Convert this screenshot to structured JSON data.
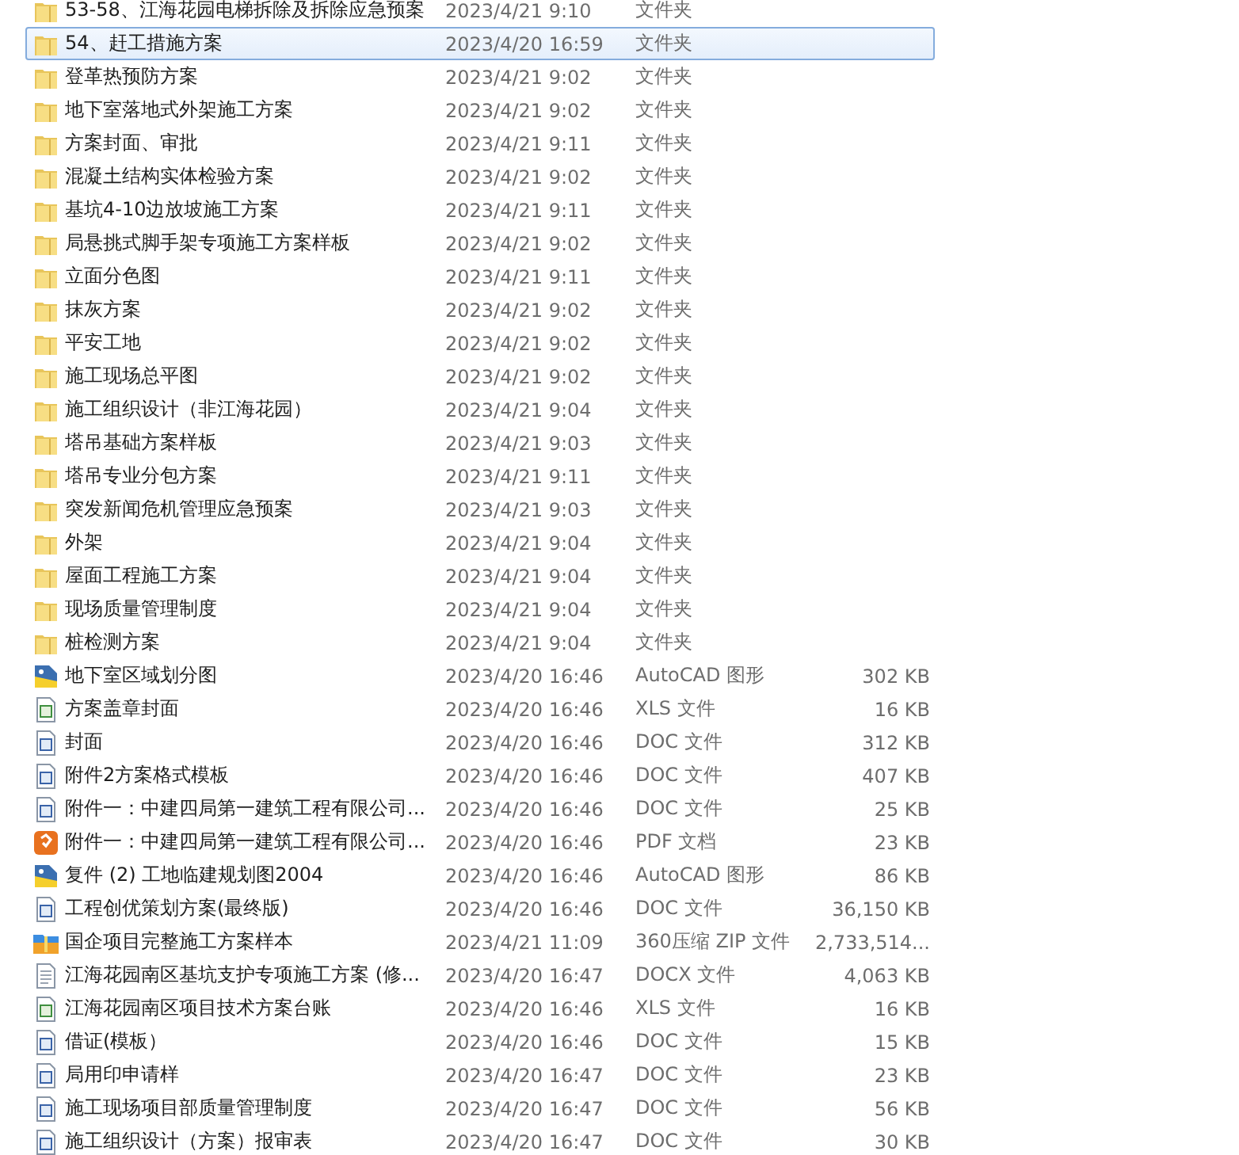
{
  "files": [
    {
      "name": "53-58、江海花园电梯拆除及拆除应急预案",
      "kind": "folder",
      "modified": "2023/4/21 9:10",
      "type": "文件夹",
      "selected": false
    },
    {
      "name": "54、赶工措施方案",
      "kind": "folder",
      "modified": "2023/4/20 16:59",
      "type": "文件夹",
      "selected": true
    },
    {
      "name": "登革热预防方案",
      "kind": "folder",
      "modified": "2023/4/21 9:02",
      "type": "文件夹",
      "selected": false
    },
    {
      "name": "地下室落地式外架施工方案",
      "kind": "folder",
      "modified": "2023/4/21 9:02",
      "type": "文件夹",
      "selected": false
    },
    {
      "name": "方案封面、审批",
      "kind": "folder",
      "modified": "2023/4/21 9:11",
      "type": "文件夹",
      "selected": false
    },
    {
      "name": "混凝土结构实体检验方案",
      "kind": "folder",
      "modified": "2023/4/21 9:02",
      "type": "文件夹",
      "selected": false
    },
    {
      "name": "基坑4-10边放坡施工方案",
      "kind": "folder",
      "modified": "2023/4/21 9:11",
      "type": "文件夹",
      "selected": false
    },
    {
      "name": "局悬挑式脚手架专项施工方案样板",
      "kind": "folder",
      "modified": "2023/4/21 9:02",
      "type": "文件夹",
      "selected": false
    },
    {
      "name": "立面分色图",
      "kind": "folder",
      "modified": "2023/4/21 9:11",
      "type": "文件夹",
      "selected": false
    },
    {
      "name": "抹灰方案",
      "kind": "folder",
      "modified": "2023/4/21 9:02",
      "type": "文件夹",
      "selected": false
    },
    {
      "name": "平安工地",
      "kind": "folder",
      "modified": "2023/4/21 9:02",
      "type": "文件夹",
      "selected": false
    },
    {
      "name": "施工现场总平图",
      "kind": "folder",
      "modified": "2023/4/21 9:02",
      "type": "文件夹",
      "selected": false
    },
    {
      "name": "施工组织设计（非江海花园）",
      "kind": "folder",
      "modified": "2023/4/21 9:04",
      "type": "文件夹",
      "selected": false
    },
    {
      "name": "塔吊基础方案样板",
      "kind": "folder",
      "modified": "2023/4/21 9:03",
      "type": "文件夹",
      "selected": false
    },
    {
      "name": "塔吊专业分包方案",
      "kind": "folder",
      "modified": "2023/4/21 9:11",
      "type": "文件夹",
      "selected": false
    },
    {
      "name": "突发新闻危机管理应急预案",
      "kind": "folder",
      "modified": "2023/4/21 9:03",
      "type": "文件夹",
      "selected": false
    },
    {
      "name": "外架",
      "kind": "folder",
      "modified": "2023/4/21 9:04",
      "type": "文件夹",
      "selected": false
    },
    {
      "name": "屋面工程施工方案",
      "kind": "folder",
      "modified": "2023/4/21 9:04",
      "type": "文件夹",
      "selected": false
    },
    {
      "name": "现场质量管理制度",
      "kind": "folder",
      "modified": "2023/4/21 9:04",
      "type": "文件夹",
      "selected": false
    },
    {
      "name": "桩检测方案",
      "kind": "folder",
      "modified": "2023/4/21 9:04",
      "type": "文件夹",
      "selected": false
    },
    {
      "name": "地下室区域划分图",
      "kind": "cad",
      "modified": "2023/4/20 16:46",
      "type": "AutoCAD 图形",
      "size": "302 KB",
      "selected": false
    },
    {
      "name": "方案盖章封面",
      "kind": "xls",
      "modified": "2023/4/20 16:46",
      "type": "XLS 文件",
      "size": "16 KB",
      "selected": false
    },
    {
      "name": "封面",
      "kind": "doc",
      "modified": "2023/4/20 16:46",
      "type": "DOC 文件",
      "size": "312 KB",
      "selected": false
    },
    {
      "name": "附件2方案格式模板",
      "kind": "doc",
      "modified": "2023/4/20 16:46",
      "type": "DOC 文件",
      "size": "407 KB",
      "selected": false
    },
    {
      "name": "附件一：中建四局第一建筑工程有限公司...",
      "kind": "doc",
      "modified": "2023/4/20 16:46",
      "type": "DOC 文件",
      "size": "25 KB",
      "selected": false
    },
    {
      "name": "附件一：中建四局第一建筑工程有限公司...",
      "kind": "pdf",
      "modified": "2023/4/20 16:46",
      "type": "PDF 文档",
      "size": "23 KB",
      "selected": false
    },
    {
      "name": "复件 (2) 工地临建规划图2004",
      "kind": "cad",
      "modified": "2023/4/20 16:46",
      "type": "AutoCAD 图形",
      "size": "86 KB",
      "selected": false
    },
    {
      "name": "工程创优策划方案(最终版)",
      "kind": "doc",
      "modified": "2023/4/20 16:46",
      "type": "DOC 文件",
      "size": "36,150 KB",
      "selected": false
    },
    {
      "name": "国企项目完整施工方案样本",
      "kind": "zip",
      "modified": "2023/4/21 11:09",
      "type": "360压缩 ZIP 文件",
      "size": "2,733,514...",
      "selected": false
    },
    {
      "name": "江海花园南区基坑支护专项施工方案 (修...",
      "kind": "text",
      "modified": "2023/4/20 16:47",
      "type": "DOCX 文件",
      "size": "4,063 KB",
      "selected": false
    },
    {
      "name": "江海花园南区项目技术方案台账",
      "kind": "xls",
      "modified": "2023/4/20 16:46",
      "type": "XLS 文件",
      "size": "16 KB",
      "selected": false
    },
    {
      "name": "借证(模板）",
      "kind": "doc",
      "modified": "2023/4/20 16:46",
      "type": "DOC 文件",
      "size": "15 KB",
      "selected": false
    },
    {
      "name": "局用印申请样",
      "kind": "doc",
      "modified": "2023/4/20 16:47",
      "type": "DOC 文件",
      "size": "23 KB",
      "selected": false
    },
    {
      "name": "施工现场项目部质量管理制度",
      "kind": "doc",
      "modified": "2023/4/20 16:47",
      "type": "DOC 文件",
      "size": "56 KB",
      "selected": false
    },
    {
      "name": "施工组织设计（方案）报审表",
      "kind": "doc",
      "modified": "2023/4/20 16:47",
      "type": "DOC 文件",
      "size": "30 KB",
      "selected": false
    }
  ]
}
